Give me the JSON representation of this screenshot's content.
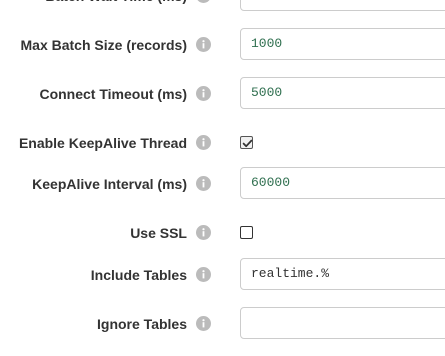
{
  "fields": [
    {
      "label": "Batch Wait Time (ms)",
      "value": ""
    },
    {
      "label": "Max Batch Size (records)",
      "value": "1000"
    },
    {
      "label": "Connect Timeout (ms)",
      "value": "5000"
    },
    {
      "label": "Enable KeepAlive Thread",
      "checked": true
    },
    {
      "label": "KeepAlive Interval (ms)",
      "value": "60000"
    },
    {
      "label": "Use SSL",
      "checked": false
    },
    {
      "label": "Include Tables",
      "value": "realtime.%"
    },
    {
      "label": "Ignore Tables",
      "value": ""
    }
  ],
  "icons": {
    "info": "info-circle-icon",
    "check": "checkmark-icon"
  },
  "colors": {
    "label_text": "#333333",
    "info_icon": "#bbbbbb",
    "input_border": "#cccccc",
    "input_value": "#2f6f4f"
  }
}
